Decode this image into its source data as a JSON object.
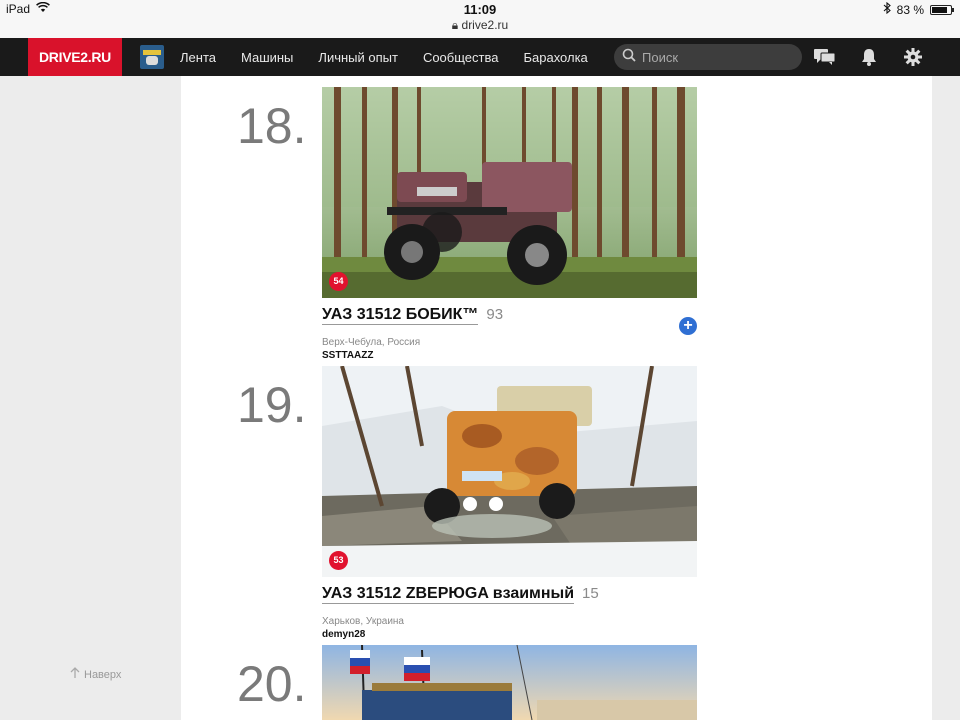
{
  "status_bar": {
    "device": "iPad",
    "time": "11:09",
    "url": "drive2.ru",
    "battery": "83 %",
    "battery_level": 0.83
  },
  "navbar": {
    "logo": "DRIVE2.RU",
    "links": [
      "Лента",
      "Машины",
      "Личный опыт",
      "Сообщества",
      "Барахолка"
    ],
    "search_placeholder": "Поиск"
  },
  "entries": [
    {
      "rank": "18.",
      "badge": "54",
      "title": "УАЗ 31512 БОБИК™",
      "votes": "93",
      "location": "Верх-Чебула, Россия",
      "owner": "SSTTAAZZ",
      "add_label": "+"
    },
    {
      "rank": "19.",
      "badge": "53",
      "title": "УАЗ 31512 ZBEPЮGA взаимный",
      "votes": "15",
      "location": "Харьков, Украина",
      "owner": "demyn28"
    },
    {
      "rank": "20."
    }
  ],
  "sidebar": {
    "to_top": "Наверх"
  }
}
